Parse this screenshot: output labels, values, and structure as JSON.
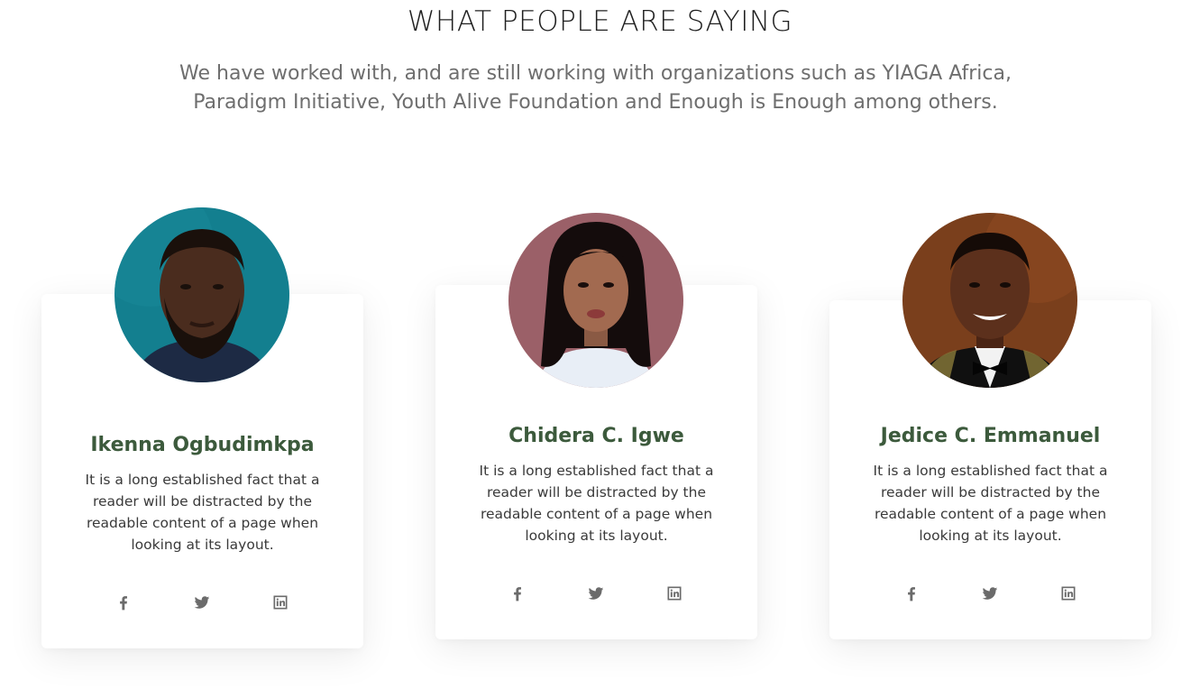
{
  "section": {
    "title": "WHAT PEOPLE ARE SAYING",
    "subtitle": "We have worked with, and are still working with organizations such as YIAGA Africa, Paradigm Initiative, Youth Alive Foundation and Enough is Enough among others."
  },
  "testimonials": [
    {
      "name": "Ikenna Ogbudimkpa",
      "text": "It is a long established fact that a reader will be distracted by the readable content of a page when looking at its layout.",
      "avatar_bg": "#137f8f",
      "socials": [
        "facebook-icon",
        "twitter-icon",
        "linkedin-icon"
      ]
    },
    {
      "name": "Chidera C. Igwe",
      "text": "It is a long established fact that a reader will be distracted by the readable content of a page when looking at its layout.",
      "avatar_bg": "#9b6068",
      "socials": [
        "facebook-icon",
        "twitter-icon",
        "linkedin-icon"
      ]
    },
    {
      "name": "Jedice C. Emmanuel",
      "text": "It is a long established fact that a reader will be distracted by the readable content of a page when looking at its layout.",
      "avatar_bg": "#7a3f1c",
      "socials": [
        "facebook-icon",
        "twitter-icon",
        "linkedin-icon"
      ]
    }
  ],
  "colors": {
    "name_green": "#3c5a3c",
    "icon_gray": "#6b6b6b",
    "heading": "#1f1f1f",
    "subtitle": "#6e6e6e"
  }
}
